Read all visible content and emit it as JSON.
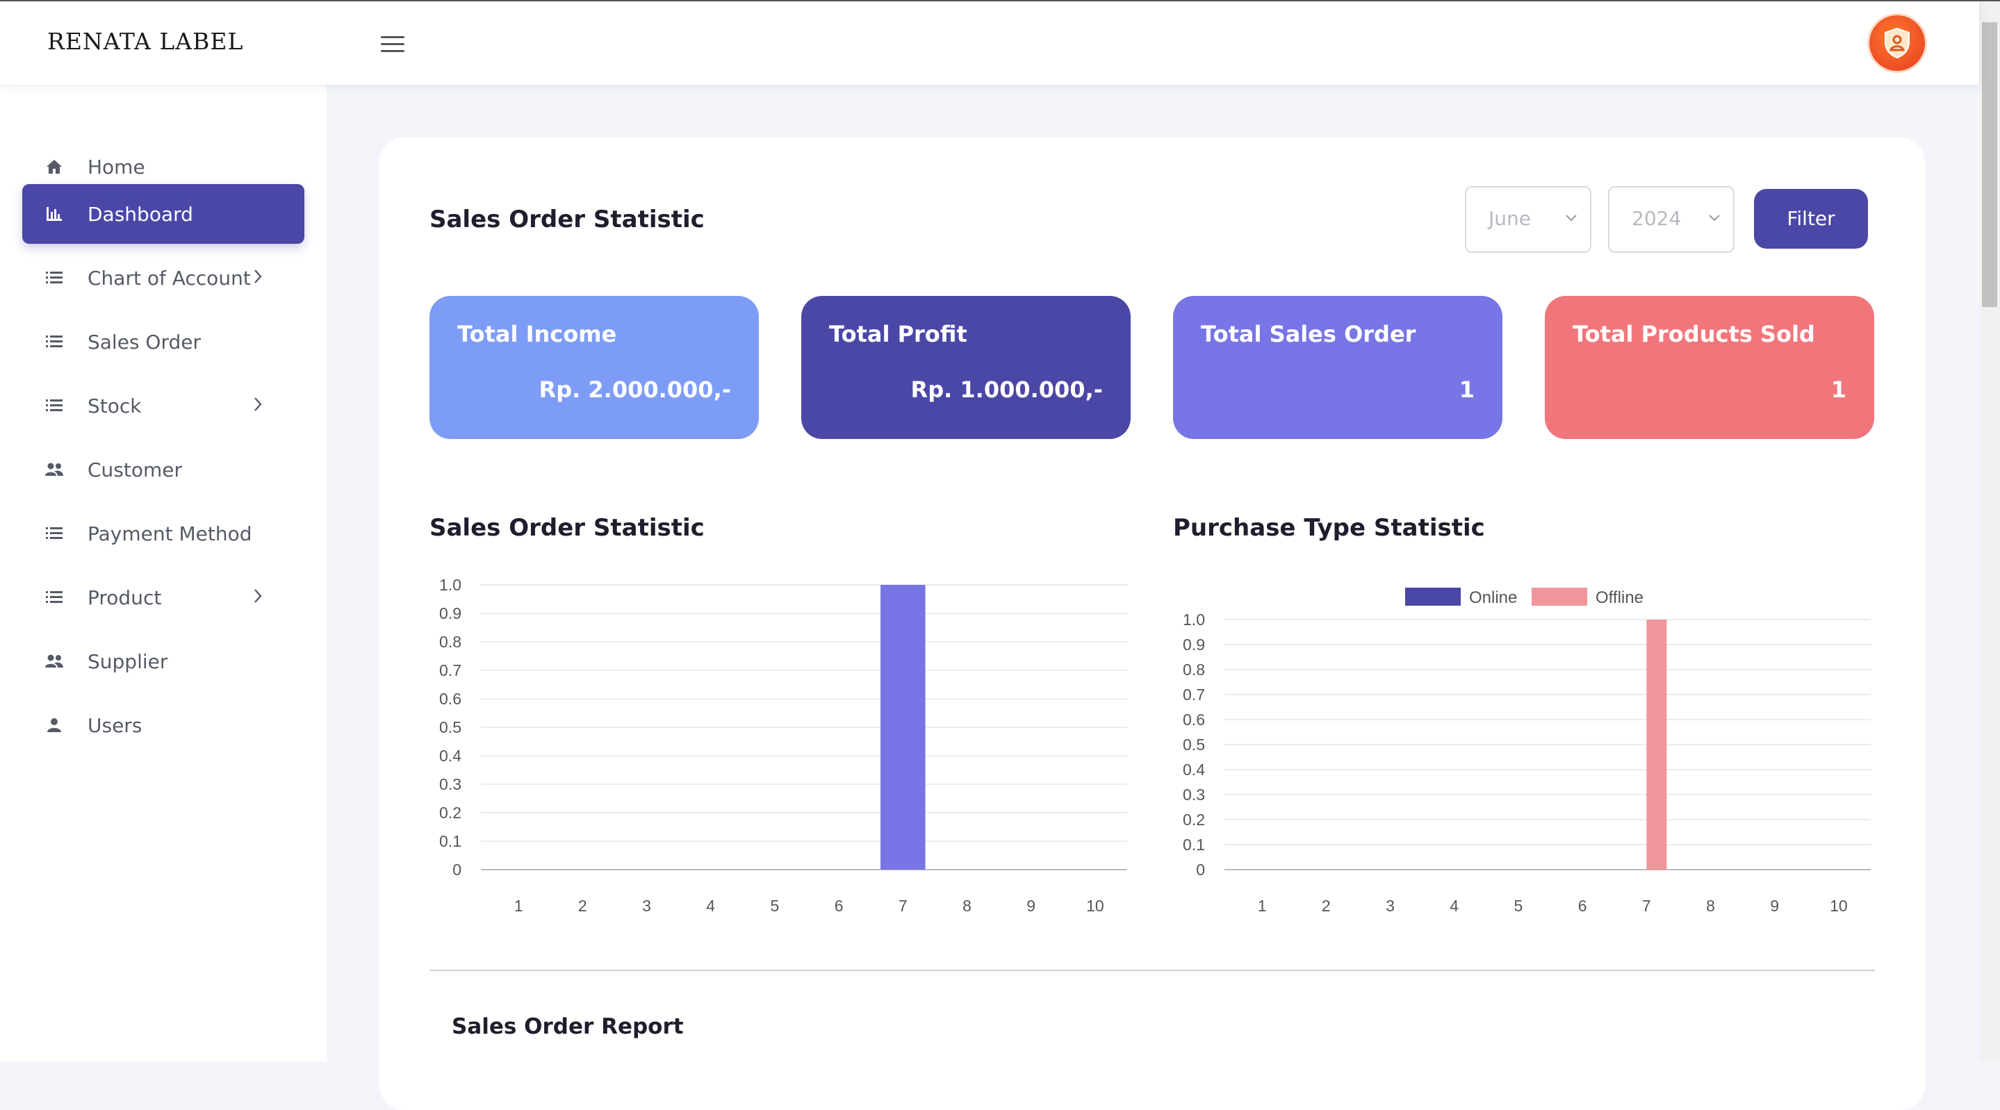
{
  "header": {
    "brand": "RENATA LABEL"
  },
  "sidebar": {
    "items": [
      {
        "label": "Home",
        "icon": "home-icon",
        "active": false,
        "chevron": false
      },
      {
        "label": "Dashboard",
        "icon": "bar-chart-icon",
        "active": true,
        "chevron": false
      },
      {
        "label": "Chart of Account",
        "icon": "list-icon",
        "active": false,
        "chevron": true
      },
      {
        "label": "Sales Order",
        "icon": "list-icon",
        "active": false,
        "chevron": false
      },
      {
        "label": "Stock",
        "icon": "list-icon",
        "active": false,
        "chevron": true
      },
      {
        "label": "Customer",
        "icon": "people-icon",
        "active": false,
        "chevron": false
      },
      {
        "label": "Payment Method",
        "icon": "list-icon",
        "active": false,
        "chevron": false
      },
      {
        "label": "Product",
        "icon": "list-icon",
        "active": false,
        "chevron": true
      },
      {
        "label": "Supplier",
        "icon": "people-icon",
        "active": false,
        "chevron": false
      },
      {
        "label": "Users",
        "icon": "person-icon",
        "active": false,
        "chevron": false
      }
    ]
  },
  "main": {
    "title": "Sales Order Statistic",
    "filters": {
      "month": "June",
      "year": "2024",
      "filter_label": "Filter"
    },
    "stats": [
      {
        "title": "Total Income",
        "value": "Rp. 2.000.000,-",
        "color": "#7d9cf6"
      },
      {
        "title": "Total Profit",
        "value": "Rp. 1.000.000,-",
        "color": "#4b47a6"
      },
      {
        "title": "Total Sales Order",
        "value": "1",
        "color": "#7875e6"
      },
      {
        "title": "Total Products Sold",
        "value": "1",
        "color": "#f1767c"
      }
    ],
    "sales_chart_title": "Sales Order Statistic",
    "purchase_chart_title": "Purchase Type Statistic",
    "report_title": "Sales Order Report"
  },
  "chart_data": [
    {
      "type": "bar",
      "categories": [
        "1",
        "2",
        "3",
        "4",
        "5",
        "6",
        "7",
        "8",
        "9",
        "10"
      ],
      "series": [
        {
          "values": [
            0,
            0,
            0,
            0,
            0,
            0,
            1,
            0,
            0,
            0
          ],
          "color": "#7875e6"
        }
      ],
      "ylim": [
        0,
        1
      ],
      "yticks": [
        "0",
        "0.1",
        "0.2",
        "0.3",
        "0.4",
        "0.5",
        "0.6",
        "0.7",
        "0.8",
        "0.9",
        "1.0"
      ],
      "grid": true
    },
    {
      "type": "bar",
      "categories": [
        "1",
        "2",
        "3",
        "4",
        "5",
        "6",
        "7",
        "8",
        "9",
        "10"
      ],
      "series": [
        {
          "name": "Online",
          "values": [
            0,
            0,
            0,
            0,
            0,
            0,
            0,
            0,
            0,
            0
          ],
          "color": "#4b47a6"
        },
        {
          "name": "Offline",
          "values": [
            0,
            0,
            0,
            0,
            0,
            0,
            1,
            0,
            0,
            0
          ],
          "color": "#f0969b"
        }
      ],
      "ylim": [
        0,
        1
      ],
      "yticks": [
        "0",
        "0.1",
        "0.2",
        "0.3",
        "0.4",
        "0.5",
        "0.6",
        "0.7",
        "0.8",
        "0.9",
        "1.0"
      ],
      "legend": "top",
      "grid": true
    }
  ]
}
